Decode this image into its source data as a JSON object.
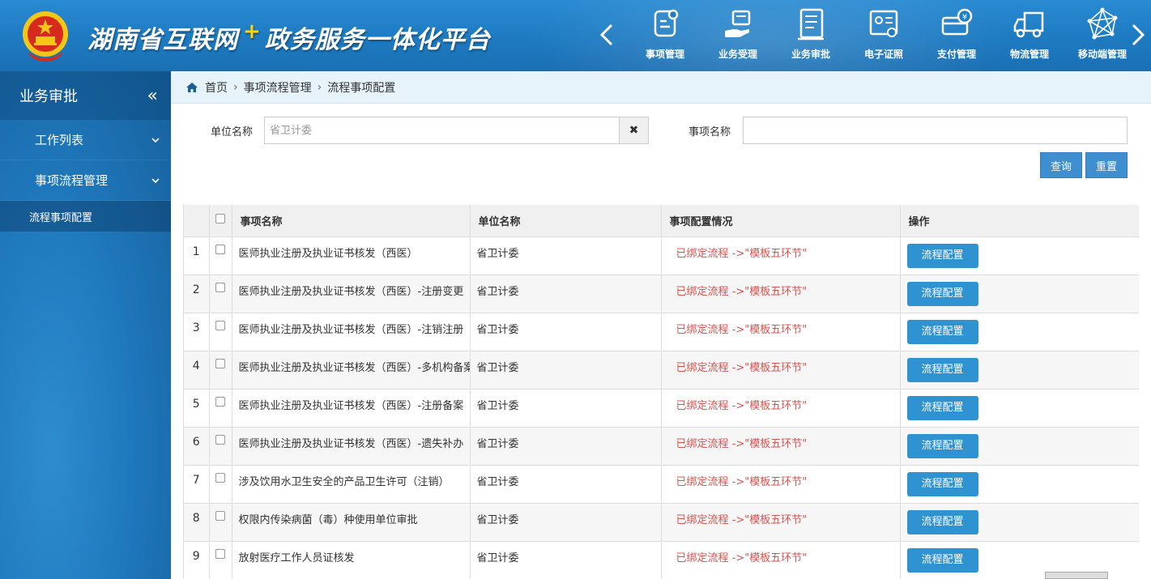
{
  "header": {
    "title_part1": "湖南省互联网",
    "plus": "+",
    "title_part2": "政务服务一体化平台",
    "nav": [
      {
        "label": "事项管理",
        "icon": "item-management-icon"
      },
      {
        "label": "业务受理",
        "icon": "business-acceptance-icon"
      },
      {
        "label": "业务审批",
        "icon": "business-approval-icon"
      },
      {
        "label": "电子证照",
        "icon": "e-license-icon"
      },
      {
        "label": "支付管理",
        "icon": "payment-icon"
      },
      {
        "label": "物流管理",
        "icon": "logistics-truck-icon"
      },
      {
        "label": "移动端管理",
        "icon": "mobile-network-icon"
      }
    ]
  },
  "sidebar": {
    "title": "业务审批",
    "collapse_glyph": "«",
    "items": [
      {
        "label": "工作列表"
      },
      {
        "label": "事项流程管理"
      }
    ],
    "sub_item": "流程事项配置"
  },
  "breadcrumb": {
    "home": "首页",
    "level1": "事项流程管理",
    "level2": "流程事项配置",
    "sep": "›"
  },
  "search": {
    "unit_label": "单位名称",
    "unit_value": "",
    "unit_placeholder": "省卫计委",
    "clear_glyph": "✖",
    "item_label": "事项名称",
    "item_value": "",
    "query_button": "查询",
    "reset_button": "重置"
  },
  "table": {
    "headers": {
      "name": "事项名称",
      "unit": "单位名称",
      "config": "事项配置情况",
      "op": "操作"
    },
    "rows": [
      {
        "num": "1",
        "name": "医师执业注册及执业证书核发（西医）",
        "unit": "省卫计委",
        "status": "已绑定流程 ->\"模板五环节\"",
        "action": "流程配置"
      },
      {
        "num": "2",
        "name": "医师执业注册及执业证书核发（西医）-注册变更",
        "unit": "省卫计委",
        "status": "已绑定流程 ->\"模板五环节\"",
        "action": "流程配置"
      },
      {
        "num": "3",
        "name": "医师执业注册及执业证书核发（西医）-注销注册",
        "unit": "省卫计委",
        "status": "已绑定流程 ->\"模板五环节\"",
        "action": "流程配置"
      },
      {
        "num": "4",
        "name": "医师执业注册及执业证书核发（西医）-多机构备案",
        "unit": "省卫计委",
        "status": "已绑定流程 ->\"模板五环节\"",
        "action": "流程配置"
      },
      {
        "num": "5",
        "name": "医师执业注册及执业证书核发（西医）-注册备案",
        "unit": "省卫计委",
        "status": "已绑定流程 ->\"模板五环节\"",
        "action": "流程配置"
      },
      {
        "num": "6",
        "name": "医师执业注册及执业证书核发（西医）-遗失补办",
        "unit": "省卫计委",
        "status": "已绑定流程 ->\"模板五环节\"",
        "action": "流程配置"
      },
      {
        "num": "7",
        "name": "涉及饮用水卫生安全的产品卫生许可（注销）",
        "unit": "省卫计委",
        "status": "已绑定流程 ->\"模板五环节\"",
        "action": "流程配置"
      },
      {
        "num": "8",
        "name": "权限内传染病菌（毒）种使用单位审批",
        "unit": "省卫计委",
        "status": "已绑定流程 ->\"模板五环节\"",
        "action": "流程配置"
      },
      {
        "num": "9",
        "name": "放射医疗工作人员证核发",
        "unit": "省卫计委",
        "status": "已绑定流程 ->\"模板五环节\"",
        "action": "流程配置"
      }
    ]
  },
  "colors": {
    "header_blue": "#1f7dc4",
    "sidebar_blue": "#1f79bd",
    "button_blue": "#2f93d1",
    "status_red": "#d9534f",
    "accent_yellow": "#ffd400"
  }
}
